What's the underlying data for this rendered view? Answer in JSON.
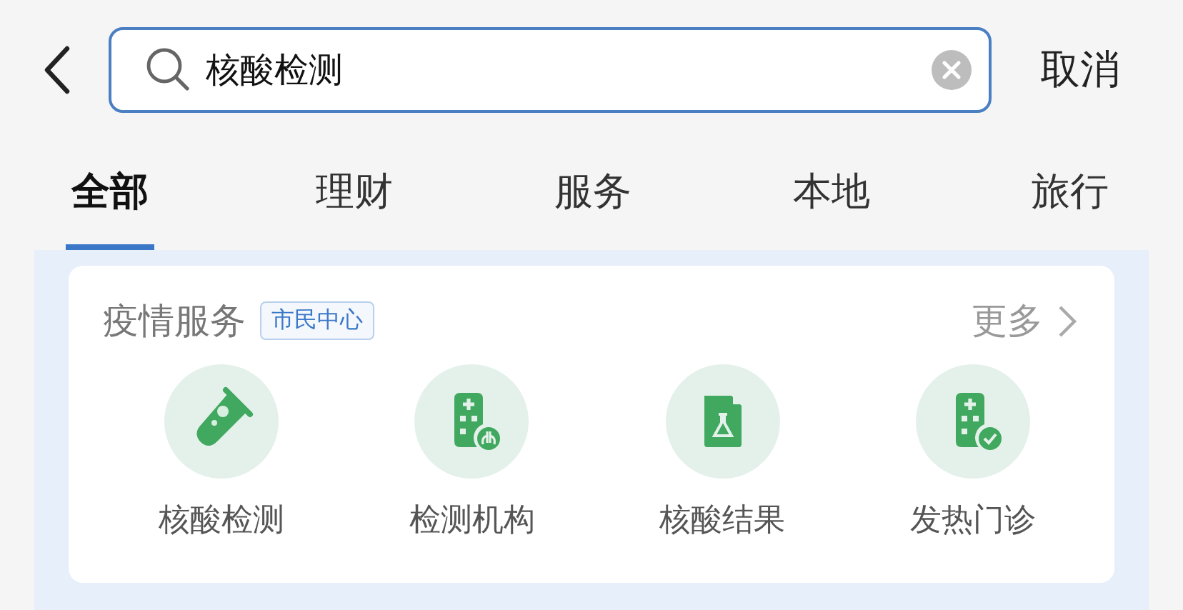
{
  "search": {
    "value": "核酸检测"
  },
  "cancel": "取消",
  "tabs": [
    {
      "label": "全部",
      "selected": true
    },
    {
      "label": "理财",
      "selected": false
    },
    {
      "label": "服务",
      "selected": false
    },
    {
      "label": "本地",
      "selected": false
    },
    {
      "label": "旅行",
      "selected": false
    }
  ],
  "card": {
    "title": "疫情服务",
    "tag": "市民中心",
    "more": "更多",
    "items": [
      {
        "label": "核酸检测",
        "kind": "tube"
      },
      {
        "label": "检测机构",
        "kind": "hospital-lungs"
      },
      {
        "label": "核酸结果",
        "kind": "report"
      },
      {
        "label": "发热门诊",
        "kind": "hospital-check"
      }
    ]
  }
}
